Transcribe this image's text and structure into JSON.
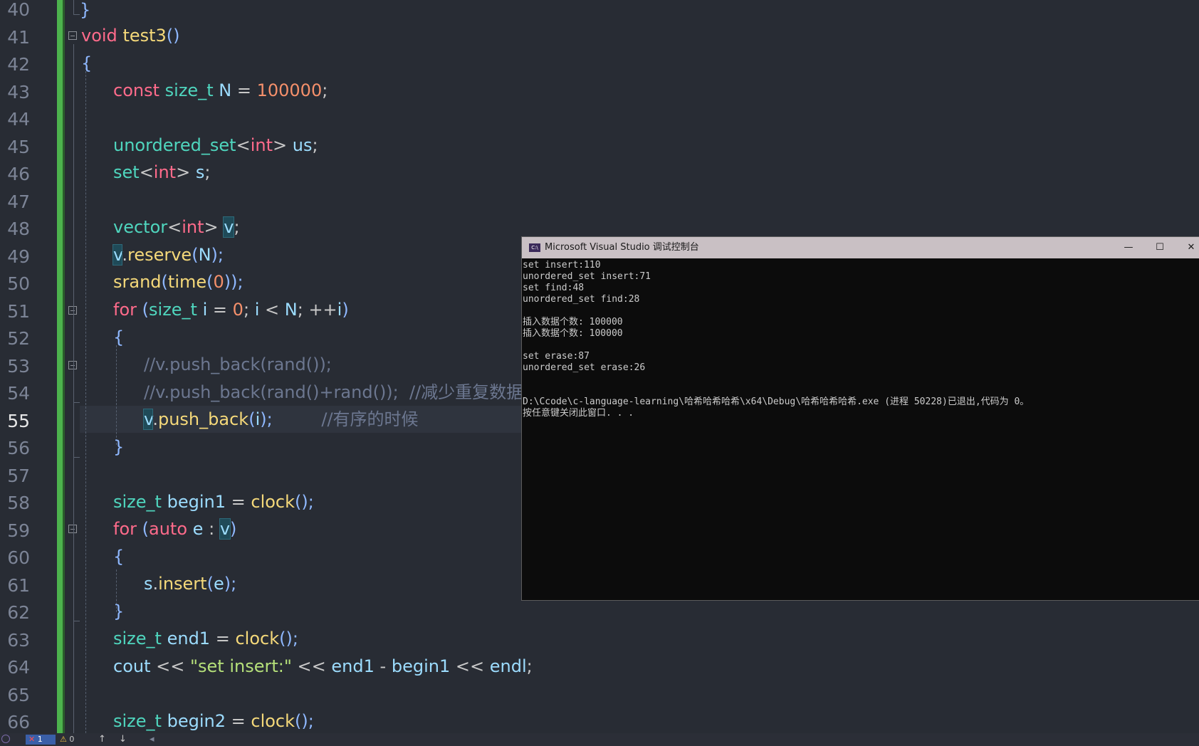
{
  "editor": {
    "current_line": "55",
    "line_numbers": [
      "40",
      "41",
      "42",
      "43",
      "44",
      "45",
      "46",
      "47",
      "48",
      "49",
      "50",
      "51",
      "52",
      "53",
      "54",
      "55",
      "56",
      "57",
      "58",
      "59",
      "60",
      "61",
      "62",
      "63",
      "64",
      "65",
      "66"
    ],
    "lines": {
      "l40": {
        "brace": "}"
      },
      "l41": {
        "void": "void",
        "name": "test3",
        "parens": "()"
      },
      "l42": {
        "brace": "{"
      },
      "l43": {
        "const": "const",
        "type": "size_t",
        "name": "N",
        "eq": "=",
        "value": "100000",
        "semi": ";"
      },
      "l45": {
        "type": "unordered_set",
        "lt": "<",
        "int": "int",
        "gt": ">",
        "name": "us",
        "semi": ";"
      },
      "l46": {
        "type": "set",
        "lt": "<",
        "int": "int",
        "gt": ">",
        "name": "s",
        "semi": ";"
      },
      "l48": {
        "type": "vector",
        "lt": "<",
        "int": "int",
        "gt": ">",
        "name": "v",
        "semi": ";"
      },
      "l49": {
        "obj": "v",
        "dot": ".",
        "fn": "reserve",
        "open": "(",
        "arg": "N",
        "close": ");"
      },
      "l50": {
        "fn": "srand",
        "open": "(",
        "fn2": "time",
        "open2": "(",
        "arg": "0",
        "close": "));"
      },
      "l51": {
        "for": "for",
        "open": "(",
        "type": "size_t",
        "i": "i",
        "eq": "=",
        "zero": "0",
        "semi1": ";",
        "i2": "i",
        "lt": "<",
        "n": "N",
        "semi2": ";",
        "inc": "++",
        "i3": "i",
        "close": ")"
      },
      "l52": {
        "brace": "{"
      },
      "l53": {
        "comment": "//v.push_back(rand());"
      },
      "l54": {
        "comment1": "//v.push_back(rand()+rand());",
        "comment2": "//减少重复数据"
      },
      "l55": {
        "obj": "v",
        "dot": ".",
        "fn": "push_back",
        "open": "(",
        "arg": "i",
        "close": ");",
        "comment": "//有序的时候"
      },
      "l56": {
        "brace": "}"
      },
      "l58": {
        "type": "size_t",
        "name": "begin1",
        "eq": "=",
        "fn": "clock",
        "call": "();"
      },
      "l59": {
        "for": "for",
        "open": "(",
        "auto": "auto",
        "e": "e",
        "colon": ":",
        "v": "v",
        "close": ")"
      },
      "l60": {
        "brace": "{"
      },
      "l61": {
        "obj": "s",
        "dot": ".",
        "fn": "insert",
        "open": "(",
        "arg": "e",
        "close": ");"
      },
      "l62": {
        "brace": "}"
      },
      "l63": {
        "type": "size_t",
        "name": "end1",
        "eq": "=",
        "fn": "clock",
        "call": "();"
      },
      "l64": {
        "cout": "cout",
        "op1": "<<",
        "str": "\"set insert:\"",
        "op2": "<<",
        "a": "end1",
        "minus": "-",
        "b": "begin1",
        "op3": "<<",
        "endl": "endl",
        "semi": ";"
      },
      "l66": {
        "type": "size_t",
        "name": "begin2",
        "eq": "=",
        "fn": "clock",
        "call": "();"
      }
    }
  },
  "console": {
    "title": "Microsoft Visual Studio 调试控制台",
    "icon_label": "C:\\",
    "icon": "console-app-icon",
    "minimize": "—",
    "maximize": "☐",
    "close": "✕",
    "lines": [
      "set insert:110",
      "unordered_set insert:71",
      "set find:48",
      "unordered_set find:28",
      "",
      "插入数据个数: 100000",
      "插入数据个数: 100000",
      "",
      "set erase:87",
      "unordered_set erase:26",
      "",
      "",
      "D:\\Ccode\\c-language-learning\\哈希哈希哈希\\x64\\Debug\\哈希哈希哈希.exe (进程 50228)已退出,代码为 0。",
      "按任意键关闭此窗口. . ."
    ]
  },
  "statusbar": {
    "errors": "1",
    "warnings": "0",
    "error_icon": "error-icon",
    "warning_icon": "warning-icon",
    "up_arrow": "↑",
    "down_arrow": "↓",
    "left_arrow": "◂"
  },
  "colors": {
    "editor_bg": "#282c34",
    "change_bar": "#4db34d",
    "keyword": "#ff6b8b",
    "type": "#4fd6be",
    "function": "#f5d97a",
    "number": "#f5906b",
    "comment": "#6c7790",
    "console_bg": "#0c0c0c",
    "console_titlebar": "#c9c0c4"
  }
}
